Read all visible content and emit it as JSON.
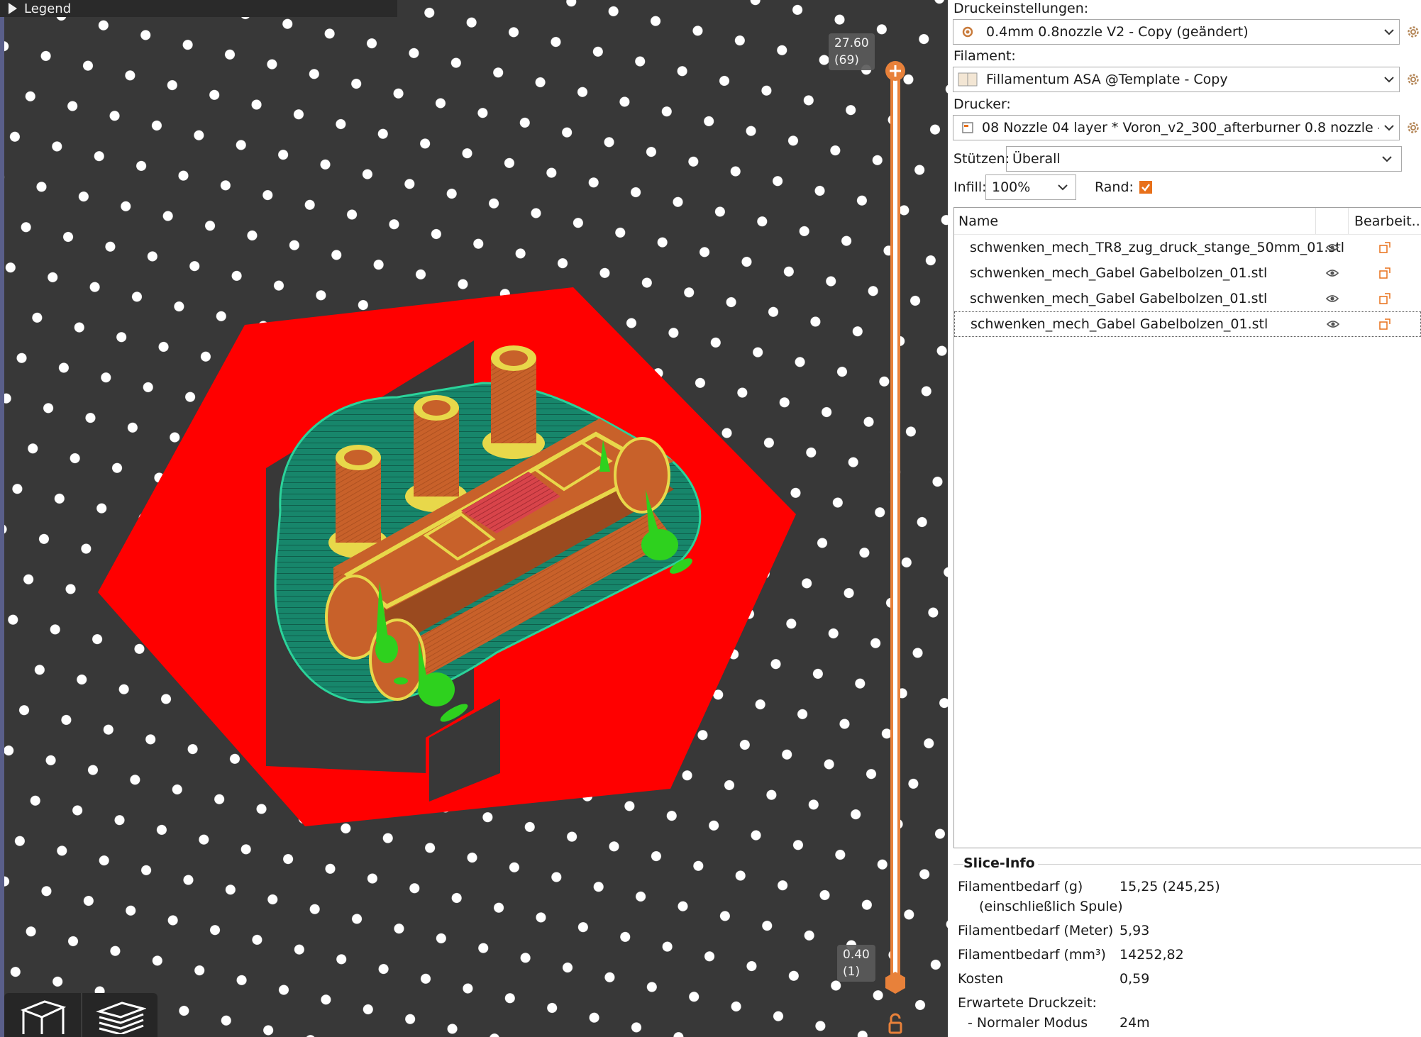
{
  "viewport": {
    "legend_label": "Legend",
    "layer_top": "27.60",
    "layer_top_index": "(69)",
    "layer_bottom": "0.40",
    "layer_bottom_index": "(1)"
  },
  "colors": {
    "bed": "#383838",
    "dots": "#ffffff",
    "brim": "#ff0000",
    "skirt_infill": "#17866b",
    "perimeter": "#c8612a",
    "top_solid": "#e8d84a",
    "support": "#2ed11e",
    "slider": "#e8813a",
    "accent_checkbox": "#e8701a"
  },
  "settings": {
    "print_label": "Druckeinstellungen:",
    "print_value": "0.4mm 0.8nozzle V2 - Copy (geändert)",
    "filament_label": "Filament:",
    "filament_value": "Fillamentum ASA @Template - Copy",
    "printer_label": "Drucker:",
    "printer_value": "08 Nozzle 04 layer * Voron_v2_300_afterburner 0.8 nozzle - 1...",
    "support_label": "Stützen:",
    "support_value": "Überall",
    "infill_label": "Infill:",
    "infill_value": "100%",
    "brim_label": "Rand:",
    "brim_checked": true
  },
  "object_list": {
    "col_name": "Name",
    "col_edit": "Bearbeit...",
    "items": [
      {
        "name": "schwenken_mech_TR8_zug_druck_stange_50mm_01.stl"
      },
      {
        "name": "schwenken_mech_Gabel Gabelbolzen_01.stl"
      },
      {
        "name": "schwenken_mech_Gabel Gabelbolzen_01.stl"
      },
      {
        "name": "schwenken_mech_Gabel Gabelbolzen_01.stl"
      }
    ]
  },
  "slice_info": {
    "title": "Slice-Info",
    "filament_g_label": "Filamentbedarf (g)",
    "filament_g_sub": "(einschließlich Spule)",
    "filament_g_value": "15,25 (245,25)",
    "filament_m_label": "Filamentbedarf (Meter)",
    "filament_m_value": "5,93",
    "filament_mm3_label": "Filamentbedarf (mm³)",
    "filament_mm3_value": "14252,82",
    "cost_label": "Kosten",
    "cost_value": "0,59",
    "time_label": "Erwartete Druckzeit:",
    "mode_label": "- Normaler Modus",
    "mode_value": "24m"
  }
}
